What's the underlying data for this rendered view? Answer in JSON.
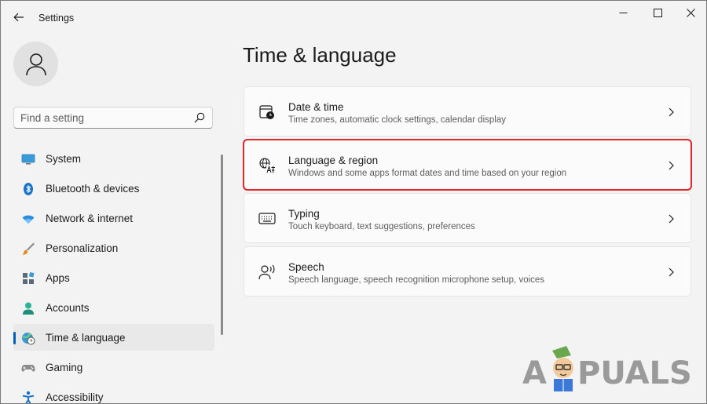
{
  "window": {
    "title": "Settings",
    "controls": [
      "minimize-icon",
      "maximize-icon",
      "close-icon"
    ]
  },
  "search": {
    "placeholder": "Find a setting",
    "value": ""
  },
  "sidebar": {
    "items": [
      {
        "label": "System",
        "icon": "system-icon",
        "active": false
      },
      {
        "label": "Bluetooth & devices",
        "icon": "bluetooth-icon",
        "active": false
      },
      {
        "label": "Network & internet",
        "icon": "wifi-icon",
        "active": false
      },
      {
        "label": "Personalization",
        "icon": "brush-icon",
        "active": false
      },
      {
        "label": "Apps",
        "icon": "apps-icon",
        "active": false
      },
      {
        "label": "Accounts",
        "icon": "accounts-icon",
        "active": false
      },
      {
        "label": "Time & language",
        "icon": "globe-clock-icon",
        "active": true
      },
      {
        "label": "Gaming",
        "icon": "gamepad-icon",
        "active": false
      },
      {
        "label": "Accessibility",
        "icon": "accessibility-icon",
        "active": false
      }
    ]
  },
  "main": {
    "title": "Time & language",
    "cards": [
      {
        "title": "Date & time",
        "description": "Time zones, automatic clock settings, calendar display",
        "icon": "calendar-clock-icon",
        "highlighted": false
      },
      {
        "title": "Language & region",
        "description": "Windows and some apps format dates and time based on your region",
        "icon": "language-icon",
        "highlighted": true
      },
      {
        "title": "Typing",
        "description": "Touch keyboard, text suggestions, preferences",
        "icon": "keyboard-icon",
        "highlighted": false
      },
      {
        "title": "Speech",
        "description": "Speech language, speech recognition microphone setup, voices",
        "icon": "speech-icon",
        "highlighted": false
      }
    ]
  },
  "watermark": {
    "text_left": "A",
    "text_right": "PUALS"
  },
  "colors": {
    "accent": "#005fb8",
    "highlight_border": "#e0262b",
    "background": "#f3f3f3",
    "card": "#fbfbfb"
  }
}
